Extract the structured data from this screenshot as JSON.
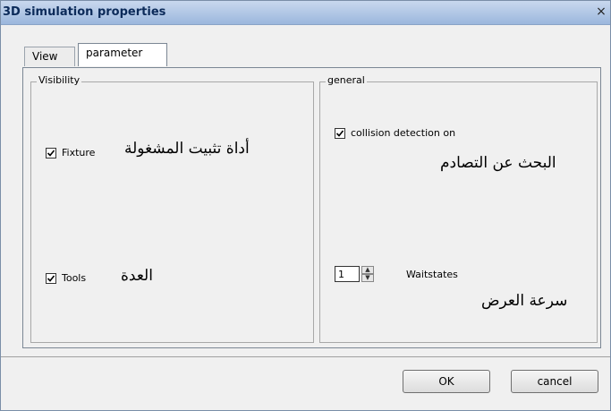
{
  "dialog": {
    "title": "3D simulation properties",
    "close_glyph": "×"
  },
  "tabs": [
    {
      "label": "View",
      "selected": false
    },
    {
      "label": "parameter",
      "selected": true
    }
  ],
  "visibility": {
    "legend": "Visibility",
    "fixture": {
      "label": "Fixture",
      "checked": true,
      "arabic": "أداة تثبيت المشغولة"
    },
    "tools": {
      "label": "Tools",
      "checked": true,
      "arabic": "العدة"
    }
  },
  "general": {
    "legend": "general",
    "collision": {
      "label": "collision detection on",
      "checked": true,
      "arabic": "البحث عن التصادم"
    },
    "waitstates": {
      "label": "Waitstates",
      "value": "1",
      "arabic": "سرعة العرض"
    }
  },
  "buttons": {
    "ok": "OK",
    "cancel": "cancel"
  },
  "icons": {
    "check": "checkmark-icon",
    "spin_up": "spin-up-icon",
    "spin_down": "spin-down-icon",
    "close": "close-icon"
  },
  "colors": {
    "title_bar": "#9bb7dd",
    "dialog_bg": "#f0f0f0"
  }
}
